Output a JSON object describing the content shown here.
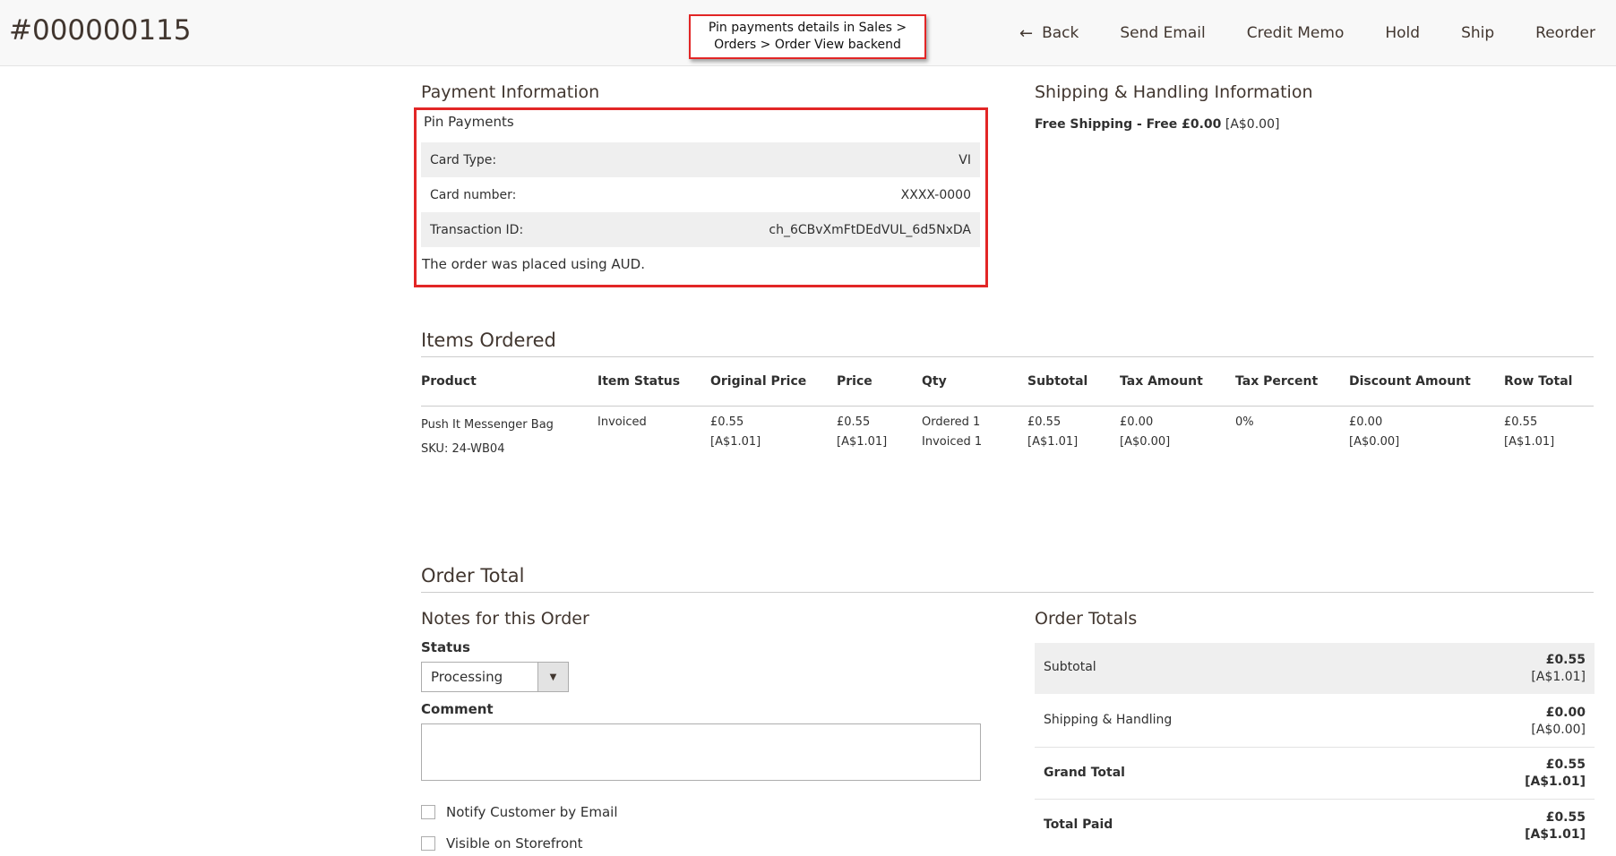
{
  "header": {
    "order_number": "#000000115",
    "callout": "Pin payments details in Sales > Orders > Order View backend",
    "actions": {
      "back": "Back",
      "send_email": "Send Email",
      "credit_memo": "Credit Memo",
      "hold": "Hold",
      "ship": "Ship",
      "reorder": "Reorder"
    }
  },
  "payment": {
    "title": "Payment Information",
    "method": "Pin Payments",
    "rows": [
      {
        "label": "Card Type:",
        "value": "VI"
      },
      {
        "label": "Card number:",
        "value": "XXXX-0000"
      },
      {
        "label": "Transaction ID:",
        "value": "ch_6CBvXmFtDEdVUL_6d5NxDA"
      }
    ],
    "note": "The order was placed using AUD."
  },
  "shipping": {
    "title": "Shipping & Handling Information",
    "method": "Free Shipping - Free £0.00",
    "base": "[A$0.00]"
  },
  "items": {
    "title": "Items Ordered",
    "columns": [
      "Product",
      "Item Status",
      "Original Price",
      "Price",
      "Qty",
      "Subtotal",
      "Tax Amount",
      "Tax Percent",
      "Discount Amount",
      "Row Total"
    ],
    "rows": [
      {
        "product": "Push It Messenger Bag",
        "sku": "SKU: 24-WB04",
        "status": "Invoiced",
        "original_price": "£0.55",
        "original_price_base": "[A$1.01]",
        "price": "£0.55",
        "price_base": "[A$1.01]",
        "qty_ordered": "Ordered 1",
        "qty_invoiced": "Invoiced 1",
        "subtotal": "£0.55",
        "subtotal_base": "[A$1.01]",
        "tax_amount": "£0.00",
        "tax_amount_base": "[A$0.00]",
        "tax_percent": "0%",
        "discount": "£0.00",
        "discount_base": "[A$0.00]",
        "row_total": "£0.55",
        "row_total_base": "[A$1.01]"
      }
    ]
  },
  "order_total": {
    "title": "Order Total",
    "notes": {
      "title": "Notes for this Order",
      "status_label": "Status",
      "status_value": "Processing",
      "comment_label": "Comment",
      "comment_value": "",
      "notify_label": "Notify Customer by Email",
      "visible_label": "Visible on Storefront"
    },
    "totals": {
      "title": "Order Totals",
      "subtotal_label": "Subtotal",
      "subtotal": "£0.55",
      "subtotal_base": "[A$1.01]",
      "shipping_label": "Shipping & Handling",
      "shipping": "£0.00",
      "shipping_base": "[A$0.00]",
      "grand_label": "Grand Total",
      "grand": "£0.55",
      "grand_base": "[A$1.01]",
      "paid_label": "Total Paid",
      "paid": "£0.55",
      "paid_base": "[A$1.01]"
    }
  }
}
